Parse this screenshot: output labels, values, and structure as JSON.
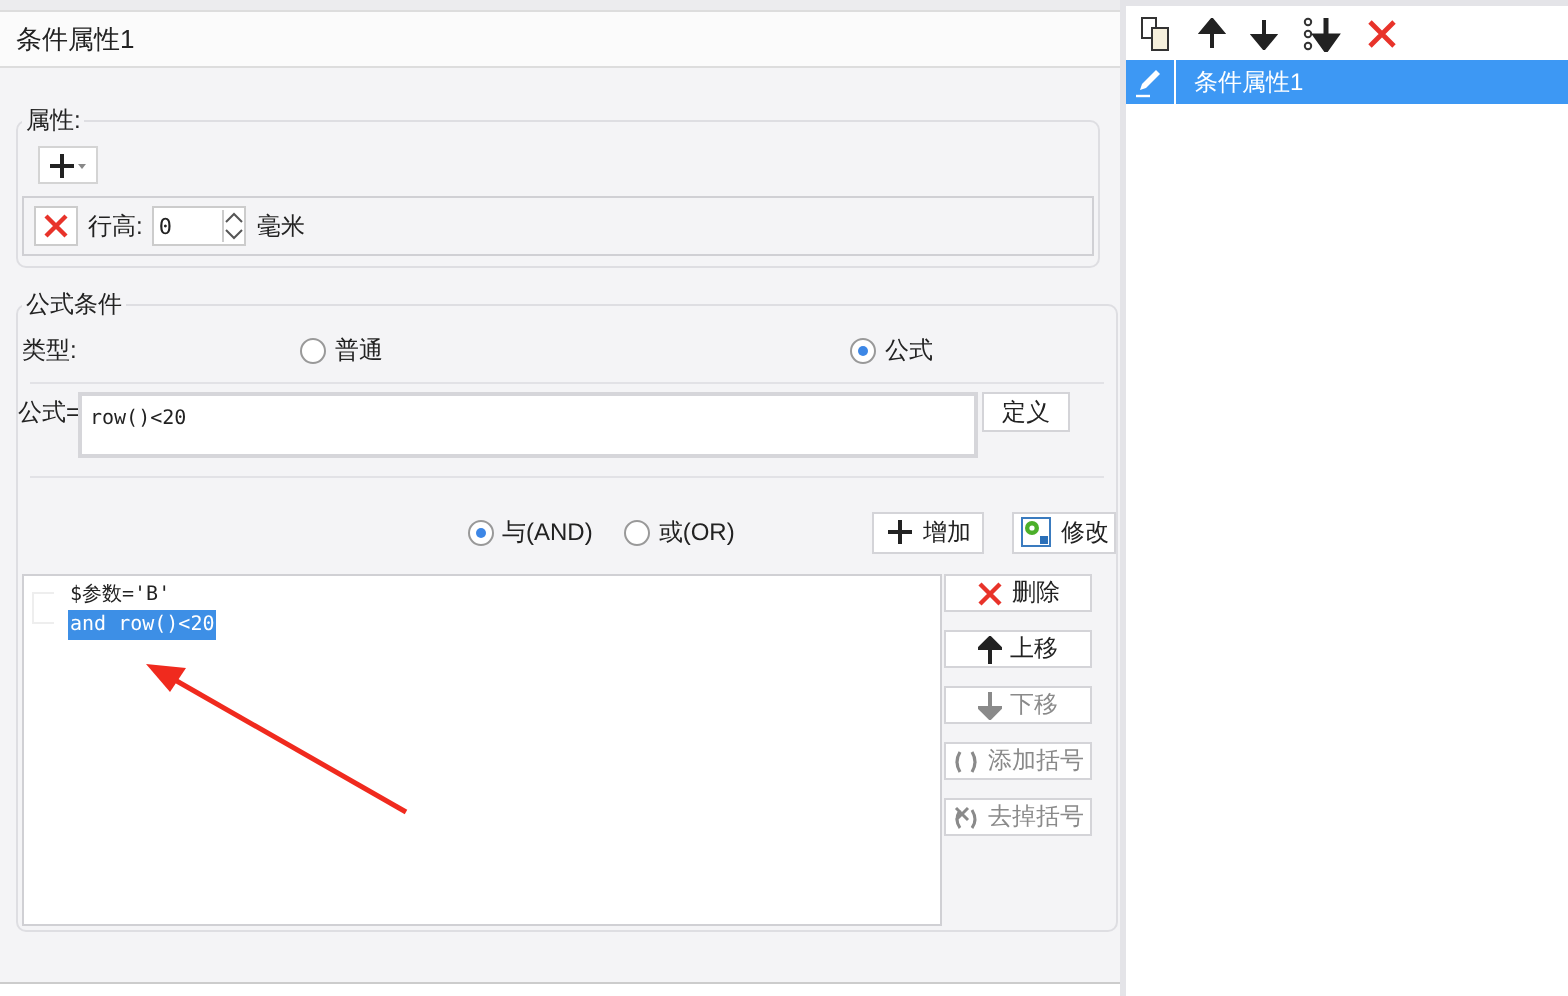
{
  "title": "条件属性1",
  "properties": {
    "legend": "属性:",
    "row_height": {
      "label": "行高:",
      "value": "0",
      "unit": "毫米"
    }
  },
  "formula_condition": {
    "legend": "公式条件",
    "type_label": "类型:",
    "types": [
      {
        "label": "普通",
        "selected": false
      },
      {
        "label": "公式",
        "selected": true
      }
    ],
    "formula_label": "公式=",
    "formula_value": "row()<20",
    "define_button": "定义",
    "logic": [
      {
        "label": "与(AND)",
        "selected": true
      },
      {
        "label": "或(OR)",
        "selected": false
      }
    ],
    "add_button": "增加",
    "modify_button": "修改",
    "conditions": [
      {
        "text": "$参数='B'",
        "selected": false
      },
      {
        "text": "and row()<20",
        "selected": true
      }
    ],
    "actions": [
      {
        "kind": "delete",
        "label": "删除",
        "disabled": false
      },
      {
        "kind": "up",
        "label": "上移",
        "disabled": false
      },
      {
        "kind": "down",
        "label": "下移",
        "disabled": true
      },
      {
        "kind": "add_paren",
        "label": "添加括号",
        "disabled": true
      },
      {
        "kind": "remove_paren",
        "label": "去掉括号",
        "disabled": true
      }
    ]
  },
  "sidebar": {
    "items": [
      {
        "label": "条件属性1",
        "selected": true
      }
    ]
  }
}
